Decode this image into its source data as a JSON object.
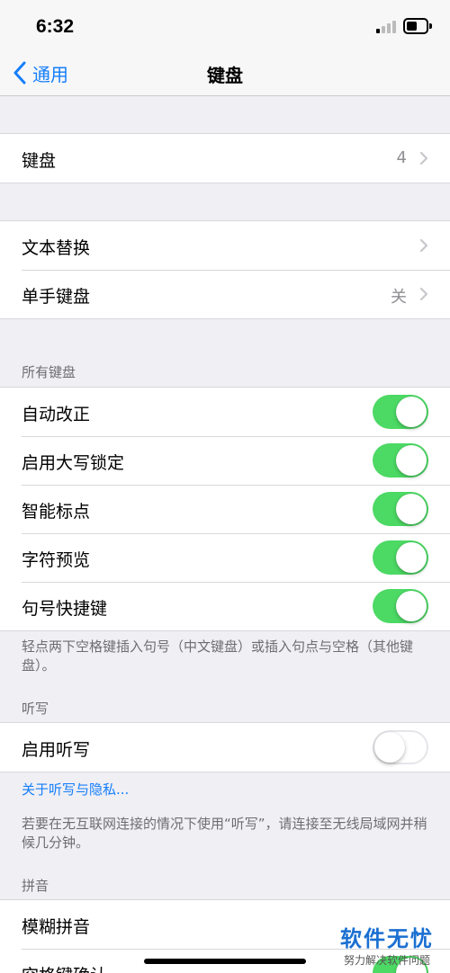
{
  "status_bar": {
    "time": "6:32",
    "icons": [
      "signal-icon",
      "battery-icon"
    ]
  },
  "nav": {
    "back_label": "通用",
    "title": "键盘"
  },
  "group1": {
    "rows": [
      {
        "label": "键盘",
        "value": "4"
      }
    ]
  },
  "group2": {
    "rows": [
      {
        "label": "文本替换",
        "value": ""
      },
      {
        "label": "单手键盘",
        "value": "关"
      }
    ]
  },
  "all_keyboards": {
    "header": "所有键盘",
    "rows": [
      {
        "label": "自动改正",
        "on": true
      },
      {
        "label": "启用大写锁定",
        "on": true
      },
      {
        "label": "智能标点",
        "on": true
      },
      {
        "label": "字符预览",
        "on": true
      },
      {
        "label": "句号快捷键",
        "on": true
      }
    ],
    "footer": "轻点两下空格键插入句号（中文键盘）或插入句点与空格（其他键盘）。"
  },
  "dictation": {
    "header": "听写",
    "rows": [
      {
        "label": "启用听写",
        "on": false
      }
    ],
    "link": "关于听写与隐私...",
    "footer": "若要在无互联网连接的情况下使用“听写”，请连接至无线局域网并稍候几分钟。"
  },
  "pinyin": {
    "header": "拼音",
    "rows": [
      {
        "label": "模糊拼音"
      },
      {
        "label": "空格键确认",
        "on": true
      }
    ]
  },
  "watermark": {
    "title": "软件无忧",
    "subtitle": "努力解决软件问题"
  },
  "colors": {
    "accent": "#157efb",
    "toggle_on": "#4cd964",
    "background": "#efeff4"
  }
}
